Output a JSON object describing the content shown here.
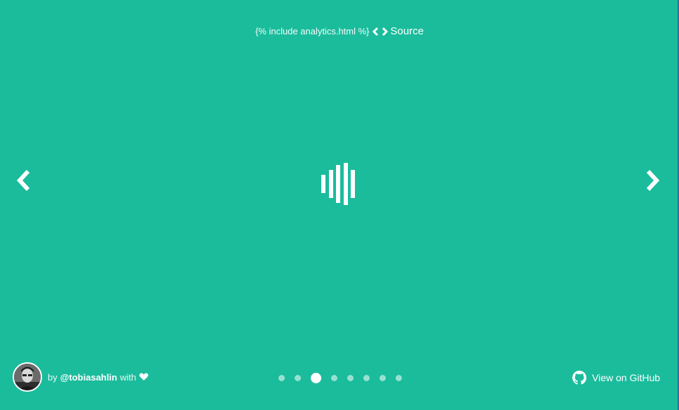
{
  "topbar": {
    "raw_include": "{% include analytics.html %}",
    "source_label": "Source"
  },
  "navigation": {
    "prev_icon": "chevron-left-icon",
    "next_icon": "chevron-right-icon"
  },
  "spinner": {
    "name": "wave-spinner",
    "bar_count": 5
  },
  "author": {
    "by_label": "by",
    "handle": "@tobiasahlin",
    "with_label": "with",
    "heart_icon": "heart-icon"
  },
  "pagination": {
    "total": 8,
    "active_index": 2
  },
  "github": {
    "label": "View on GitHub",
    "icon": "github-icon"
  },
  "colors": {
    "background": "#1abc9c",
    "foreground": "#ffffff",
    "edge_strip": "#2c6fa6"
  }
}
